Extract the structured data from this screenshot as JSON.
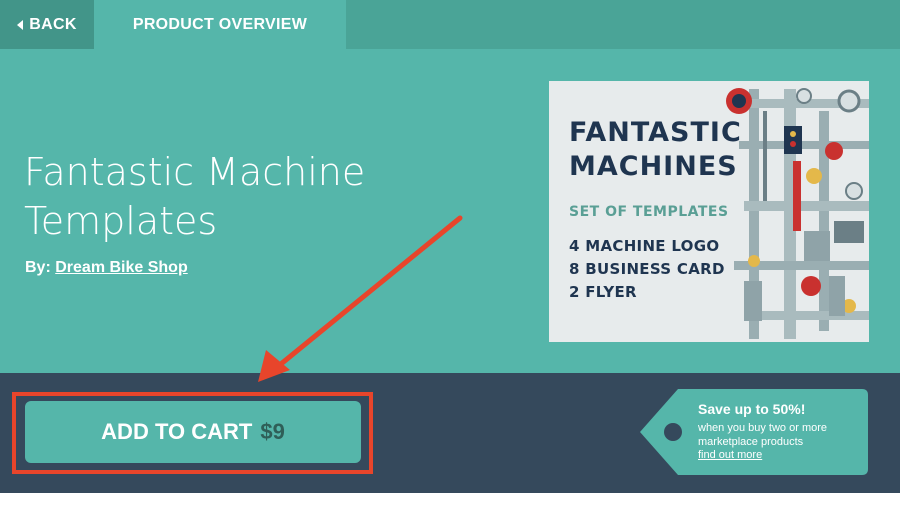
{
  "nav": {
    "back_label": "BACK",
    "active_tab_label": "PRODUCT OVERVIEW"
  },
  "product": {
    "title": "Fantastic Machine Templates",
    "by_label": "By:",
    "author": "Dream Bike Shop"
  },
  "thumbnail": {
    "line1": "FANTASTIC",
    "line2": "MACHINES",
    "subtitle": "SET OF TEMPLATES",
    "item1": "4 MACHINE LOGO",
    "item2": "8 BUSINESS CARD",
    "item3": "2 FLYER"
  },
  "cart": {
    "label": "ADD TO CART",
    "price": "$9"
  },
  "promo": {
    "headline": "Save up to 50%!",
    "body": "when you buy two or more marketplace products",
    "link": "find out more"
  },
  "colors": {
    "hero_bg": "#55b6aa",
    "nav_bg": "#4aa497",
    "bar_bg": "#35495c",
    "highlight": "#e8452b"
  }
}
